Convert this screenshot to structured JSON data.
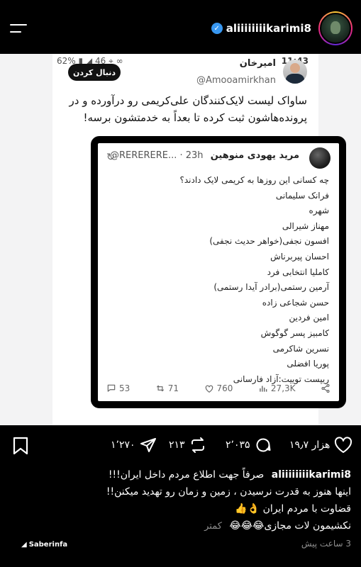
{
  "header": {
    "username": "aliiiiiiiikarimi8"
  },
  "post": {
    "status_left": "62% ▮ ◢ 46 ⌖ ∞",
    "status_time": "11:43",
    "follow_label": "دنبال کردن",
    "tweet_author": "امیرخان",
    "tweet_handle": "@Amooamirkhan",
    "tweet_text": "ساواک لیست لایک‌کنندگان علی‌کریمی رو درآورده و در پرونده‌هاشون ثبت کرده تا بعداً به خدمتشون برسه!",
    "quoted": {
      "author": "مرید یهودی منوهین",
      "handle": "@RERERERE... · 23h",
      "lines": [
        "چه کسانی این روزها به کریمی لایک دادند؟",
        "فرانک سلیمانی",
        "شهره",
        "مهناز شیرالی",
        "افسون نجفی(خواهر حدیث نجفی)",
        "احسان پیربرناش",
        "کاملیا انتخابی فرد",
        "آرمین رستمی(برادر آیدا رستمی)",
        "حسن شجاعی زاده",
        "امین فردین",
        "کامبیز پسر گوگوش",
        "نسرین شاکرمی",
        "پوریا افضلی",
        "ریپست توییت:آزاد فارسانی"
      ],
      "stats": {
        "comments": "53",
        "retweets": "71",
        "likes": "760",
        "views": "27,3K"
      }
    }
  },
  "actions": {
    "likes": "۱۹٫۷ هزار",
    "comments": "۲٬۰۳۵",
    "reposts": "۲۱۳",
    "shares": "۱٬۲۷۰"
  },
  "caption": {
    "username": "aliiiiiiiikarimi8",
    "line1": "صرفاً جهت اطلاع مردم داخل ایران!!!",
    "line2": "اینها هنوز به قدرت نرسیدن ، زمین و زمان رو تهدید میکنن!!",
    "line3": "قضاوت با مردم ایران 👌👍",
    "line4": "نکشیمون لات مجازی😂😂😂",
    "more": "کمتر",
    "time_ago": "3 ساعت پیش",
    "watermark": "Saberinfa"
  },
  "colors": {
    "verified": "#3897f0",
    "background": "#000000"
  }
}
